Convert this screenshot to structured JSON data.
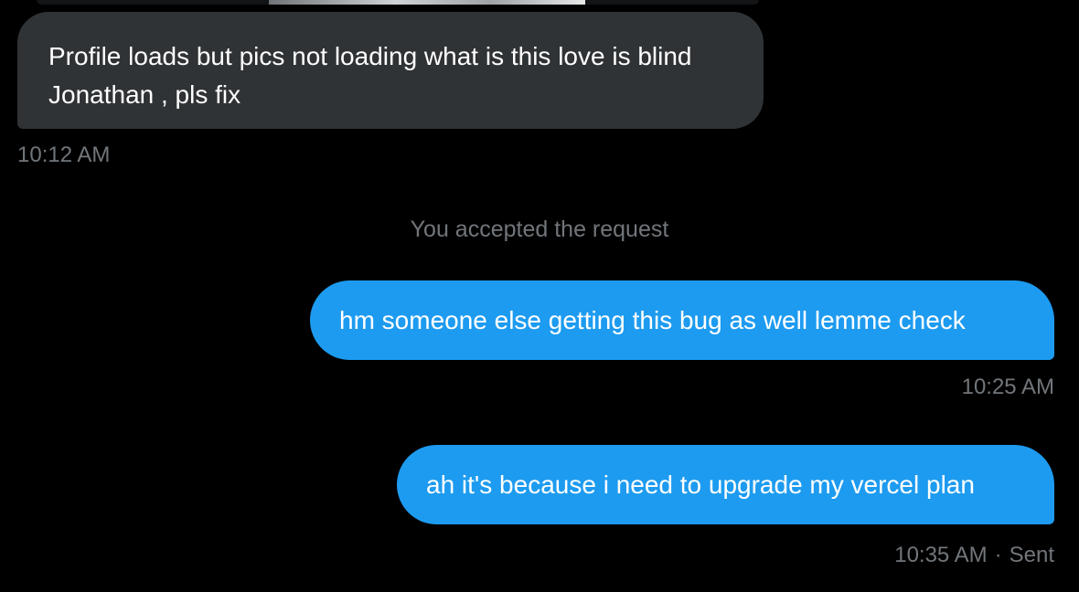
{
  "conversation": {
    "messages": [
      {
        "direction": "incoming",
        "text": "Profile loads but pics not loading what is this love is blind Jonathan , pls fix",
        "time": "10:12 AM"
      },
      {
        "direction": "outgoing",
        "text": "hm someone else getting this bug as well lemme check",
        "time": "10:25 AM"
      },
      {
        "direction": "outgoing",
        "text": "ah it's because i need to upgrade my vercel plan",
        "time": "10:35 AM",
        "status_separator": "·",
        "status": "Sent"
      }
    ],
    "system_note": "You accepted the request"
  },
  "colors": {
    "background": "#000000",
    "incoming_bubble": "#2f3336",
    "outgoing_bubble": "#1d9bf0",
    "muted_text": "#71767b",
    "text": "#ffffff"
  }
}
